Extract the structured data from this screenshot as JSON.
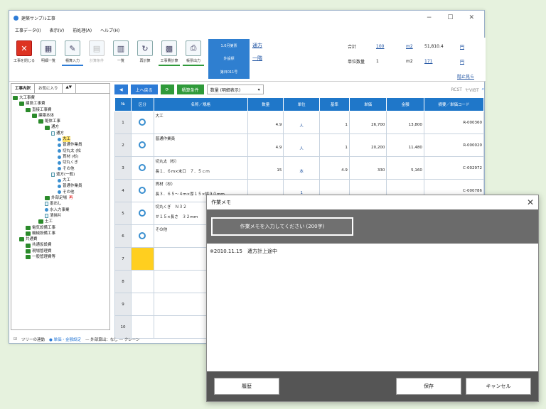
{
  "window": {
    "title": "建築サンプル工事",
    "controls": [
      "−",
      "☐",
      "✕"
    ]
  },
  "menu": [
    "工事データ(I)",
    "表示(V)",
    "前処理(A)",
    "ヘルプ(H)"
  ],
  "toolbar": {
    "buttons": [
      {
        "label": "工事を閉じる",
        "icon": "✕"
      },
      {
        "label": "明細一覧",
        "icon": "▦"
      },
      {
        "label": "積算入力",
        "icon": "✎"
      },
      {
        "label": "計算条件",
        "icon": "▤"
      },
      {
        "label": "一覧",
        "icon": "▥"
      },
      {
        "label": "再計算",
        "icon": "↻"
      },
      {
        "label": "工事費計算",
        "icon": "▩"
      },
      {
        "label": "帳票出力",
        "icon": "⎙"
      }
    ],
    "bluebox": [
      "1.0月第票",
      "外設標",
      "第日011号"
    ],
    "links": [
      "通方",
      "一階"
    ],
    "info": [
      [
        "合計",
        "100",
        "m2",
        "51,810.4",
        "円"
      ],
      [
        "単位数量",
        "1",
        "m2",
        "171",
        "円"
      ]
    ],
    "info_link": "階止見ら"
  },
  "tree": {
    "tabs": [
      "工事内訳",
      "お気に入り",
      "▲▼"
    ],
    "nodes": [
      {
        "text": "大工事費",
        "ind": 0,
        "k": "fold"
      },
      {
        "text": "建設工事費",
        "ind": 1,
        "k": "fold"
      },
      {
        "text": "直接工事費",
        "ind": 2,
        "k": "fold"
      },
      {
        "text": "建築本体",
        "ind": 3,
        "k": "fold"
      },
      {
        "text": "躯体工事",
        "ind": 4,
        "k": "fold"
      },
      {
        "text": "通方",
        "ind": 5,
        "k": "fold"
      },
      {
        "text": "通方",
        "ind": 6,
        "k": "doc"
      },
      {
        "text": "大工",
        "ind": 7,
        "k": "dot",
        "sel": true
      },
      {
        "text": "普通作業員",
        "ind": 7,
        "k": "dot"
      },
      {
        "text": "切丸太 (松",
        "ind": 7,
        "k": "dot"
      },
      {
        "text": "貫材 (杉)",
        "ind": 7,
        "k": "dot"
      },
      {
        "text": "切丸くぎ",
        "ind": 7,
        "k": "dot"
      },
      {
        "text": "その他",
        "ind": 7,
        "k": "dot"
      },
      {
        "text": "遣方(一般)",
        "ind": 6,
        "k": "doc"
      },
      {
        "text": "大工",
        "ind": 7,
        "k": "dot"
      },
      {
        "text": "普通作業員",
        "ind": 7,
        "k": "dot"
      },
      {
        "text": "その他",
        "ind": 7,
        "k": "dot"
      },
      {
        "text": "外部足場",
        "ind": 5,
        "k": "fold",
        "red": "再"
      },
      {
        "text": "墨出し",
        "ind": 5,
        "k": "doc"
      },
      {
        "text": "水入力事業",
        "ind": 5,
        "k": "dot"
      },
      {
        "text": "清掃片",
        "ind": 5,
        "k": "doc"
      },
      {
        "text": "土工",
        "ind": 4,
        "k": "fold"
      },
      {
        "text": "電気設備工事",
        "ind": 2,
        "k": "fold"
      },
      {
        "text": "機械設備工事",
        "ind": 2,
        "k": "fold"
      },
      {
        "text": "共通費",
        "ind": 1,
        "k": "fold"
      },
      {
        "text": "共通仮設費",
        "ind": 2,
        "k": "fold"
      },
      {
        "text": "現場管理費",
        "ind": 2,
        "k": "fold"
      },
      {
        "text": "一般管理費等",
        "ind": 2,
        "k": "fold"
      }
    ]
  },
  "gridbar": {
    "up": "上へ戻る",
    "filter": "積算条件",
    "combo": "数量 (明細表示)",
    "right": [
      "RCST",
      "ヤVIBT"
    ]
  },
  "grid": {
    "headers": [
      "№",
      "区分",
      "名称／規格",
      "数量",
      "単位",
      "基準",
      "単価",
      "金額",
      "摘要／単価コード"
    ],
    "rows": [
      {
        "n": "1",
        "name": "大工",
        "spec": "",
        "qty": "4.9",
        "unit": "人",
        "base": "1",
        "price": "26,700",
        "amt": "13,800",
        "code": "R-000360"
      },
      {
        "n": "2",
        "name": "普通作業員",
        "spec": "",
        "qty": "4.9",
        "unit": "人",
        "base": "1",
        "price": "20,200",
        "amt": "11,480",
        "code": "R-000020"
      },
      {
        "n": "3",
        "name": "切丸太（杉）",
        "spec": "長１．６ｍ×末口　７．５ｃｍ",
        "qty": "15",
        "unit": "本",
        "base": "4.9",
        "price": "330",
        "amt": "5,160",
        "code": "C-002972"
      },
      {
        "n": "4",
        "name": "貫材（杉）",
        "spec": "長３．６５〜４ｍ×厚１５×幅９０ｍｍ",
        "qty": "",
        "unit": "1",
        "base": "",
        "price": "",
        "amt": "",
        "code": "C-000786"
      },
      {
        "n": "5",
        "name": "切丸くぎ　Ｎ３２",
        "spec": "＃１５×長さ　３２ｍｍ",
        "qty": "",
        "unit": "",
        "base": "",
        "price": "",
        "amt": "",
        "code": ""
      },
      {
        "n": "6",
        "name": "その他",
        "spec": "",
        "qty": "",
        "unit": "",
        "base": "",
        "price": "",
        "amt": "",
        "code": ""
      },
      {
        "n": "7",
        "name": "",
        "spec": "",
        "qty": "",
        "unit": "",
        "base": "",
        "price": "",
        "amt": "",
        "code": ""
      },
      {
        "n": "8",
        "name": "",
        "spec": "",
        "qty": "",
        "unit": "",
        "base": "",
        "price": "",
        "amt": "",
        "code": ""
      },
      {
        "n": "9",
        "name": "",
        "spec": "",
        "qty": "",
        "unit": "",
        "base": "",
        "price": "",
        "amt": "",
        "code": ""
      },
      {
        "n": "10",
        "name": "",
        "spec": "",
        "qty": "",
        "unit": "",
        "base": "",
        "price": "",
        "amt": "",
        "code": ""
      }
    ]
  },
  "status": {
    "tree_link": "ツリーの連動",
    "item1": "● 単価・金額設定",
    "item2": "— 外部算出：なし ― クレーン"
  },
  "dialog": {
    "title": "作業メモ",
    "memo_btn": "作業メモを入力してください (200字)",
    "content": "※2010.11.15　遣方計上途中",
    "history": "履歴",
    "save": "保存",
    "cancel": "キャンセル",
    "close": "✕"
  },
  "colors": {
    "accent": "#2c7bd6",
    "header": "#1f77c9",
    "highlight": "#ffcf1f"
  }
}
